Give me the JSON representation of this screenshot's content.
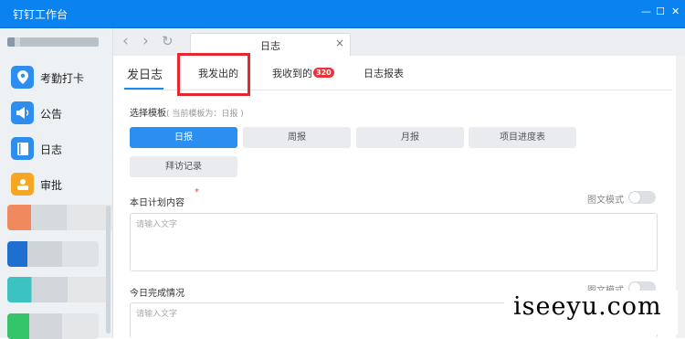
{
  "window": {
    "title": "钉钉工作台",
    "controls": {
      "minimize": "—",
      "maximize": "☐",
      "close": "✕"
    }
  },
  "sidebar": {
    "items": [
      {
        "label": "考勤打卡",
        "icon": "location-pin-icon",
        "color": "#2e8ef0"
      },
      {
        "label": "公告",
        "icon": "megaphone-icon",
        "color": "#2e8ef0"
      },
      {
        "label": "日志",
        "icon": "notebook-icon",
        "color": "#2e8ef0"
      },
      {
        "label": "审批",
        "icon": "person-stamp-icon",
        "color": "#f5a623"
      }
    ]
  },
  "toolbar": {
    "back": "‹",
    "forward": "›",
    "refresh": "↻"
  },
  "browser_tab": {
    "title": "日志",
    "close": "×"
  },
  "subtabs": [
    {
      "label": "发日志",
      "active": true
    },
    {
      "label": "我发出的",
      "highlighted": true
    },
    {
      "label": "我收到的",
      "badge": "320"
    },
    {
      "label": "日志报表"
    }
  ],
  "template_section": {
    "label": "选择模板",
    "hint": "( 当前模板为：日报 )",
    "options": [
      {
        "label": "日报",
        "selected": true
      },
      {
        "label": "周报"
      },
      {
        "label": "月报"
      },
      {
        "label": "项目进度表"
      },
      {
        "label": "拜访记录"
      }
    ]
  },
  "fields": [
    {
      "label": "本日计划内容",
      "required": "*",
      "toggle_label": "图文模式",
      "placeholder": "请输入文字"
    },
    {
      "label": "今日完成情况",
      "toggle_label": "图文模式",
      "placeholder": "请输入文字"
    }
  ],
  "watermark": "iseeyu.com",
  "colors": {
    "accent": "#2b8ff2",
    "titlebar": "#0a82f0",
    "highlight": "#e5282e",
    "badge": "#e8333a"
  }
}
